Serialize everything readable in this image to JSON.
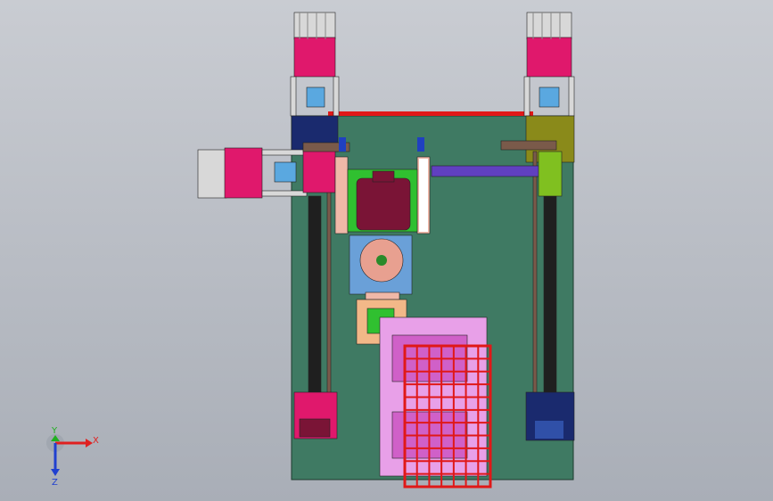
{
  "view": {
    "background_top": "#c9ccd2",
    "background_bottom": "#a9aeb7"
  },
  "triad": {
    "x_label": "X",
    "y_label": "Y",
    "z_label": "Z",
    "x_color": "#e02020",
    "y_color": "#20b020",
    "z_color": "#2040d0"
  },
  "colors": {
    "base_plate": "#3f7a63",
    "motor": "#e0186c",
    "motor_flange": "#d8d8d8",
    "coupling": "#5aa8e0",
    "bracket_navy": "#1a2a6e",
    "bracket_olive": "#8a8a1a",
    "lead_screw": "#1f1f1f",
    "rail": "#7a5a4a",
    "belt": "#e01818",
    "gantry_pink": "#f0b8a8",
    "carriage_green": "#30c030",
    "spindle_maroon": "#7a1436",
    "spindle_head_blue": "#6aa0d8",
    "disc_pink": "#e8a090",
    "holder_peach": "#f2b888",
    "tray_violet": "#e8a0e8",
    "tray_magenta": "#d060c8",
    "grid_red": "#e01818",
    "screw_purple": "#6040c0",
    "side_block_green": "#80c020"
  }
}
